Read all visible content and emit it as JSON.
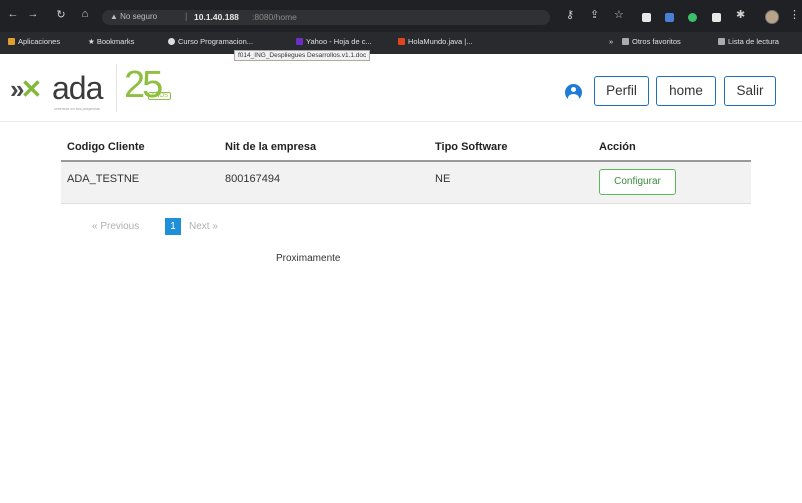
{
  "browser": {
    "url_warning": "▲ No seguro",
    "url_host": "10.1.40.188",
    "url_path": ":8080/home",
    "bookmarks": [
      "Aplicaciones",
      "Bookmarks",
      "Curso Programacion...",
      "Yahoo - Hoja de c...",
      "HolaMundo.java |...",
      "Otros favoritos",
      "Lista de lectura"
    ],
    "tooltip": "f014_ING_Despliegues Desarrollos.v1.1.doc",
    "icons": [
      "back-icon",
      "forward-icon",
      "reload-icon",
      "home-icon",
      "key-icon",
      "share-icon",
      "star-icon",
      "extension-icon",
      "puzzle-icon",
      "profile-icon",
      "menu-icon"
    ]
  },
  "header": {
    "logo_text": "ada",
    "logo_tagline": "creemos en tus proyectos",
    "anniversary_number": "25",
    "anniversary_label": "AÑOS",
    "buttons": {
      "profile": "Perfil",
      "home": "home",
      "logout": "Salir"
    },
    "accent_color": "#1f6fbf",
    "brand_green": "#83b83a"
  },
  "table": {
    "columns": [
      "Codigo Cliente",
      "Nit de la empresa",
      "Tipo Software",
      "Acción"
    ],
    "rows": [
      {
        "codigo": "ADA_TESTNE",
        "nit": "800167494",
        "tipo": "NE",
        "accion": "Configurar"
      }
    ]
  },
  "pagination": {
    "previous": "« Previous",
    "current": "1",
    "next": "Next »"
  },
  "footer_text": "Proximamente"
}
